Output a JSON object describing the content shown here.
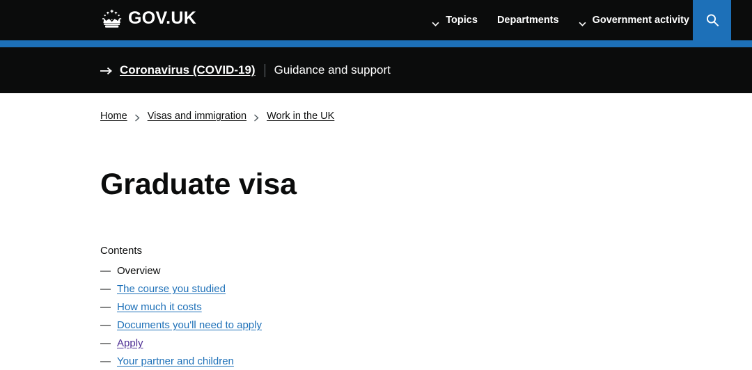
{
  "header": {
    "logo_text": "GOV.UK",
    "logo_icon": "crown-icon",
    "nav": [
      {
        "label": "Topics",
        "has_chevron": true
      },
      {
        "label": "Departments",
        "has_chevron": false
      },
      {
        "label": "Government activity",
        "has_chevron": true
      }
    ],
    "search_icon": "search-icon",
    "accent_color": "#1d70b8",
    "background_color": "#0b0c0c"
  },
  "covid_banner": {
    "arrow_icon": "arrow-right-icon",
    "link_label": "Coronavirus (COVID-19)",
    "divider": "|",
    "description": "Guidance and support"
  },
  "breadcrumb": {
    "items": [
      {
        "label": "Home"
      },
      {
        "label": "Visas and immigration"
      },
      {
        "label": "Work in the UK"
      }
    ]
  },
  "main": {
    "page_title": "Graduate visa",
    "contents_label": "Contents",
    "contents": [
      {
        "label": "Overview",
        "state": "current"
      },
      {
        "label": "The course you studied",
        "state": "link"
      },
      {
        "label": "How much it costs",
        "state": "link"
      },
      {
        "label": "Documents you'll need to apply",
        "state": "link"
      },
      {
        "label": "Apply",
        "state": "visited"
      },
      {
        "label": "Your partner and children",
        "state": "link"
      }
    ],
    "bullet": "—"
  },
  "colors": {
    "link_blue": "#1d70b8",
    "visited_purple": "#4c2c92",
    "text_black": "#0b0c0c"
  }
}
